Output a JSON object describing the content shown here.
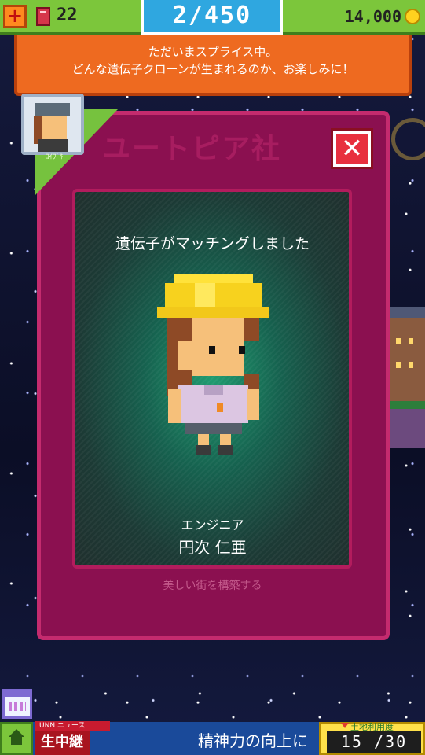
{
  "hud": {
    "books": "22",
    "population": "2/450",
    "coins": "14,000"
  },
  "banner": {
    "line1": "ただいまスプライス中。",
    "line2": "どんな遺伝子クローンが生まれるのか、お楽しみに！"
  },
  "avatar": {
    "tag": "ｺｲﾌﾞｷ"
  },
  "card": {
    "title": "ユートピア社",
    "close_label": "✕",
    "heading": "遺伝子がマッチングしました",
    "job": "エンジニア",
    "name": "円次 仁亜",
    "subtitle": "美しい街を構築する"
  },
  "bottom": {
    "news_tag": "UNN ニュース",
    "live": "生中継",
    "ticker": "精神力の向上に",
    "counter_label": "土地利用度",
    "counter": "15 /30"
  },
  "colors": {
    "hud_green": "#7cc63b",
    "counter_blue": "#2fa7e0",
    "banner_orange": "#ee6a20",
    "card_magenta": "#8b1050",
    "close_red": "#e8303e"
  }
}
